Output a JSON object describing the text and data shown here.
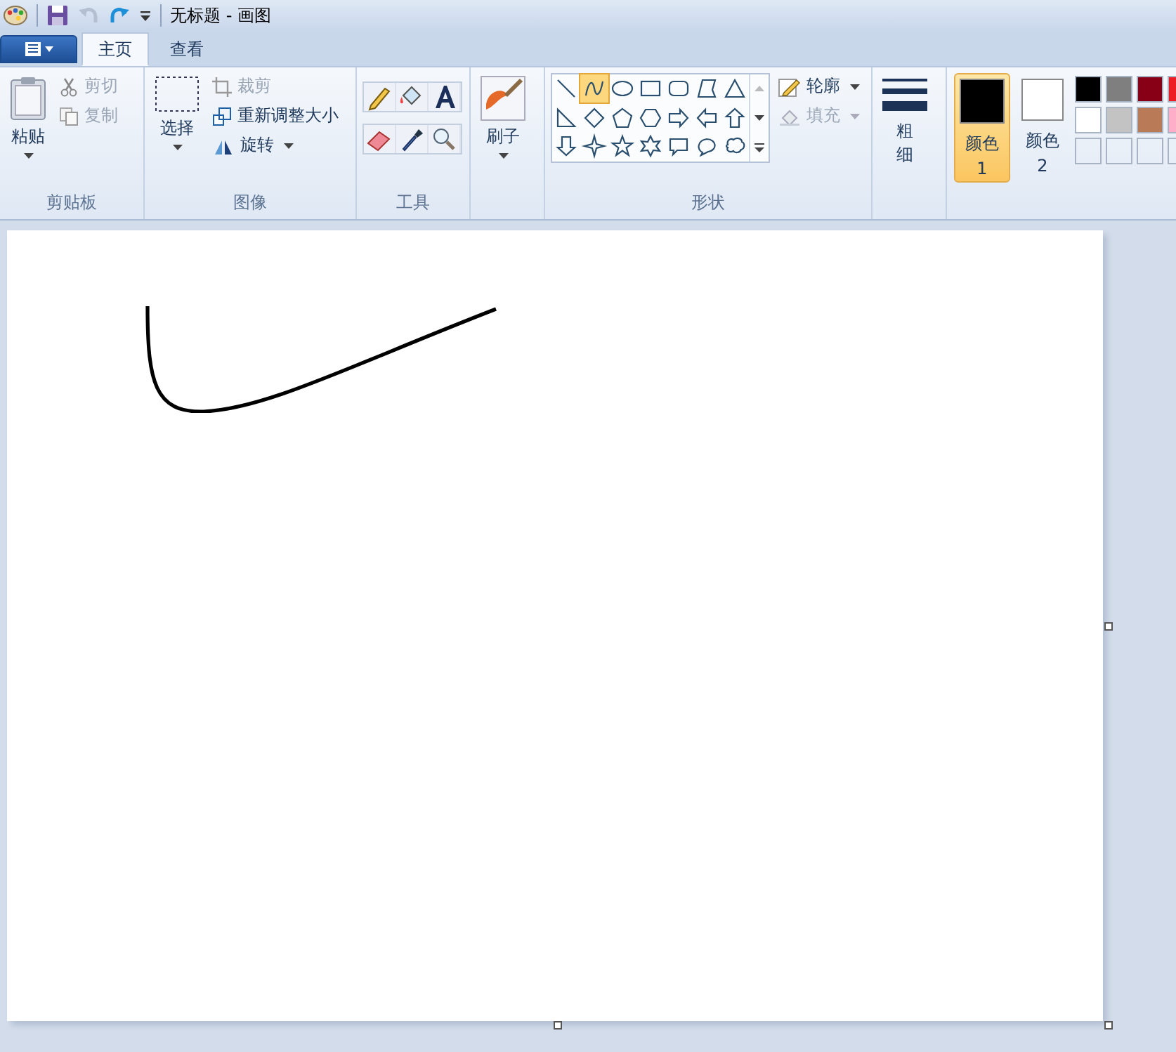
{
  "window": {
    "title": "无标题 - 画图"
  },
  "tabs": [
    {
      "label": "主页",
      "selected": true
    },
    {
      "label": "查看",
      "selected": false
    }
  ],
  "clipboard": {
    "paste": "粘贴",
    "cut": {
      "label": "剪切",
      "disabled": true
    },
    "copy": {
      "label": "复制",
      "disabled": true
    },
    "group_label": "剪贴板"
  },
  "image": {
    "select": "选择",
    "crop": {
      "label": "裁剪",
      "disabled": true
    },
    "resize": "重新调整大小",
    "rotate": "旋转",
    "group_label": "图像"
  },
  "tools": {
    "group_label": "工具"
  },
  "brushes": {
    "label": "刷子"
  },
  "shapes": {
    "items": [
      {
        "kind": "line",
        "selected": false
      },
      {
        "kind": "curve",
        "selected": true
      },
      {
        "kind": "oval",
        "selected": false
      },
      {
        "kind": "rect",
        "selected": false
      },
      {
        "kind": "roundrect",
        "selected": false
      },
      {
        "kind": "polygon",
        "selected": false
      },
      {
        "kind": "triangle",
        "selected": false
      },
      {
        "kind": "right-triangle",
        "selected": false
      },
      {
        "kind": "diamond",
        "selected": false
      },
      {
        "kind": "pentagon",
        "selected": false
      },
      {
        "kind": "hexagon",
        "selected": false
      },
      {
        "kind": "arrow-right",
        "selected": false
      },
      {
        "kind": "arrow-left",
        "selected": false
      },
      {
        "kind": "arrow-up",
        "selected": false
      },
      {
        "kind": "arrow-down",
        "selected": false
      },
      {
        "kind": "star4",
        "selected": false
      },
      {
        "kind": "star5",
        "selected": false
      },
      {
        "kind": "star6",
        "selected": false
      },
      {
        "kind": "callout-rect",
        "selected": false
      },
      {
        "kind": "callout-oval",
        "selected": false
      },
      {
        "kind": "callout-cloud",
        "selected": false
      }
    ],
    "outline": {
      "label": "轮廓",
      "disabled": false
    },
    "fill": {
      "label": "填充",
      "disabled": true
    },
    "group_label": "形状"
  },
  "size": {
    "label": "粗细"
  },
  "colors": [
    {
      "label": "颜色 1",
      "selected": true,
      "color": "#000000"
    },
    {
      "label": "颜色 2",
      "selected": false,
      "color": "#ffffff"
    }
  ],
  "palette": [
    {
      "kind": "swatch",
      "color": "#000000"
    },
    {
      "kind": "swatch",
      "color": "#7f7f7f"
    },
    {
      "kind": "swatch",
      "color": "#880015"
    },
    {
      "kind": "swatch",
      "color": "#ed1c24"
    },
    {
      "kind": "swatch",
      "color": "#ffffff"
    },
    {
      "kind": "swatch",
      "color": "#c3c3c3"
    },
    {
      "kind": "swatch",
      "color": "#b97a57"
    },
    {
      "kind": "swatch",
      "color": "#ffaec9"
    },
    {
      "kind": "empty"
    },
    {
      "kind": "empty"
    },
    {
      "kind": "empty"
    },
    {
      "kind": "empty"
    }
  ]
}
